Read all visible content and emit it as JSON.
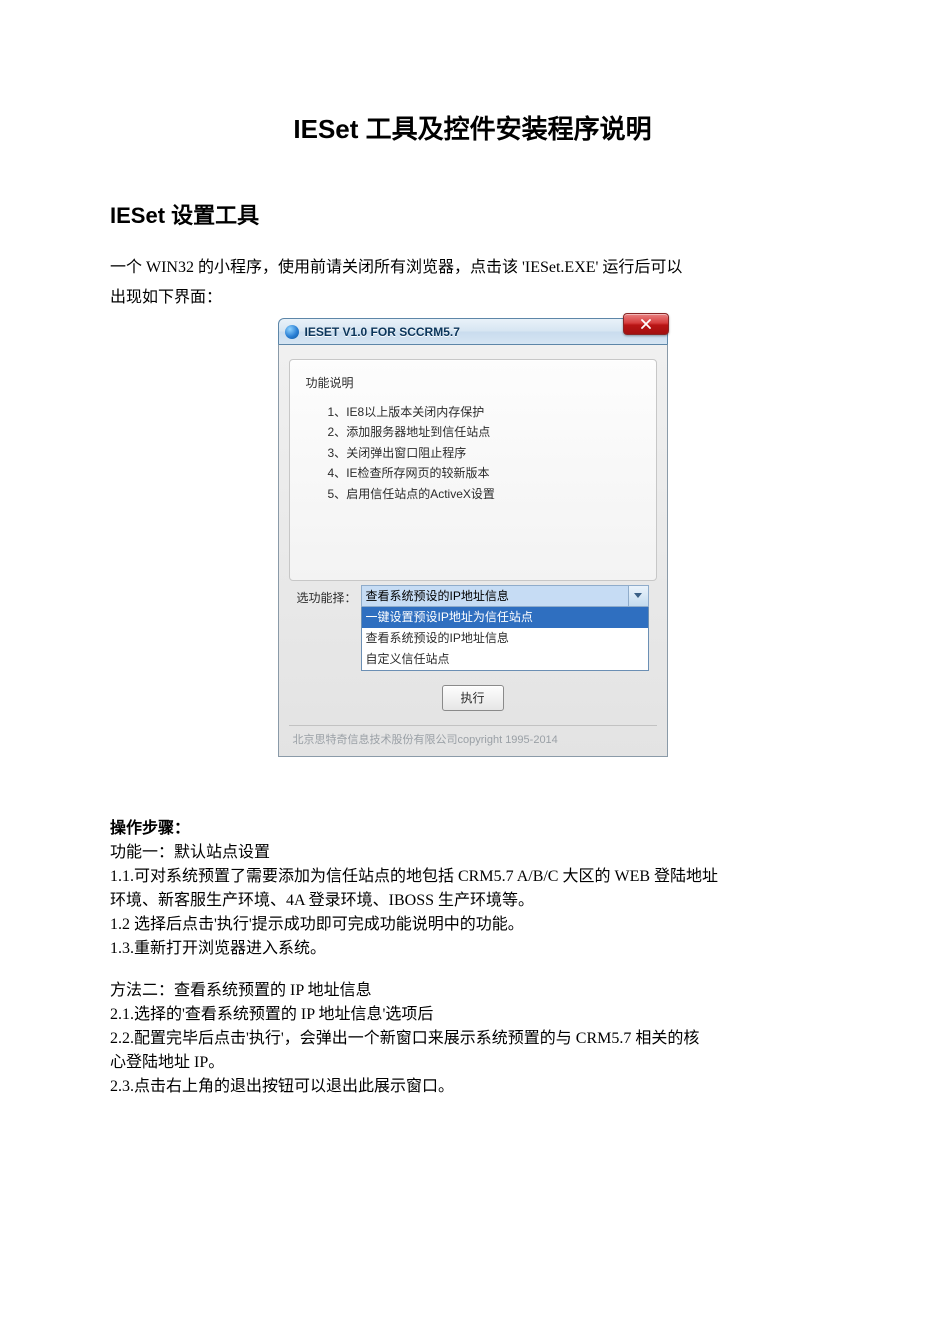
{
  "doc": {
    "title": "IESet 工具及控件安装程序说明",
    "section1_heading": "IESet 设置工具",
    "intro_line1": "一个 WIN32 的小程序，使用前请关闭所有浏览器，点击该 'IESet.EXE' 运行后可以",
    "intro_line2": "出现如下界面："
  },
  "app": {
    "titlebar": "IESET V1.0  FOR SCCRM5.7",
    "group_title": "功能说明",
    "feature_items": [
      {
        "num": "1、",
        "text": "IE8以上版本关闭内存保护"
      },
      {
        "num": "2、",
        "text": "添加服务器地址到信任站点"
      },
      {
        "num": "3、",
        "text": "关闭弹出窗口阻止程序"
      },
      {
        "num": "4、",
        "text": "IE检查所存网页的较新版本"
      },
      {
        "num": "5、",
        "text": "启用信任站点的ActiveX设置"
      }
    ],
    "select_label": "选功能择：",
    "select_current": "查看系统预设的IP地址信息",
    "select_options": [
      {
        "text": "一键设置预设IP地址为信任站点",
        "selected": true
      },
      {
        "text": "查看系统预设的IP地址信息",
        "selected": false
      },
      {
        "text": "自定义信任站点",
        "selected": false
      }
    ],
    "execute_label": "执行",
    "copyright": "北京思特奇信息技术股份有限公司copyright 1995-2014"
  },
  "steps": {
    "heading": "操作步骤：",
    "m1_title": "功能一：默认站点设置",
    "m1_1a": "1.1.可对系统预置了需要添加为信任站点的地包括 CRM5.7 A/B/C 大区的 WEB 登陆地址",
    "m1_1b": "环境、新客服生产环境、4A 登录环境、IBOSS 生产环境等。",
    "m1_2": "1.2 选择后点击'执行'提示成功即可完成功能说明中的功能。",
    "m1_3": "1.3.重新打开浏览器进入系统。",
    "m2_title": "方法二：查看系统预置的 IP 地址信息",
    "m2_1": "2.1.选择的'查看系统预置的 IP 地址信息'选项后",
    "m2_2a": "2.2.配置完毕后点击'执行'，会弹出一个新窗口来展示系统预置的与 CRM5.7 相关的核",
    "m2_2b": "心登陆地址 IP。",
    "m2_3": "2.3.点击右上角的退出按钮可以退出此展示窗口。"
  }
}
